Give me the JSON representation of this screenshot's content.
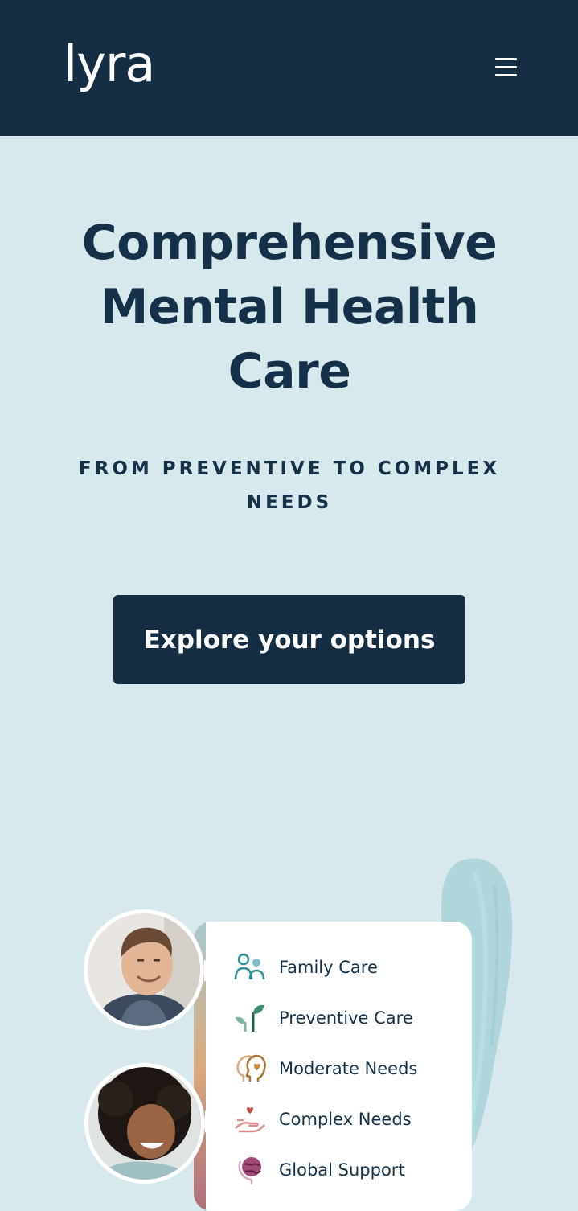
{
  "header": {
    "logo_text": "lyra",
    "menu_label": "Menu"
  },
  "hero": {
    "title": "Comprehensive Mental Health Care",
    "subtitle": "FROM PREVENTIVE TO COMPLEX NEEDS",
    "cta_label": "Explore your options"
  },
  "care_list": [
    {
      "label": "Family Care",
      "icon": "family-icon",
      "color": "#2a8f98"
    },
    {
      "label": "Preventive Care",
      "icon": "sprout-icon",
      "color": "#3b8f6e"
    },
    {
      "label": "Moderate Needs",
      "icon": "heads-heart-icon",
      "color": "#b4823f"
    },
    {
      "label": "Complex Needs",
      "icon": "hand-heart-icon",
      "color": "#c76a6a"
    },
    {
      "label": "Global Support",
      "icon": "globe-icon",
      "color": "#8b2e5c"
    }
  ],
  "colors": {
    "navy": "#142d43",
    "background": "#d7e9ec",
    "brush": "#a9d2d9"
  }
}
